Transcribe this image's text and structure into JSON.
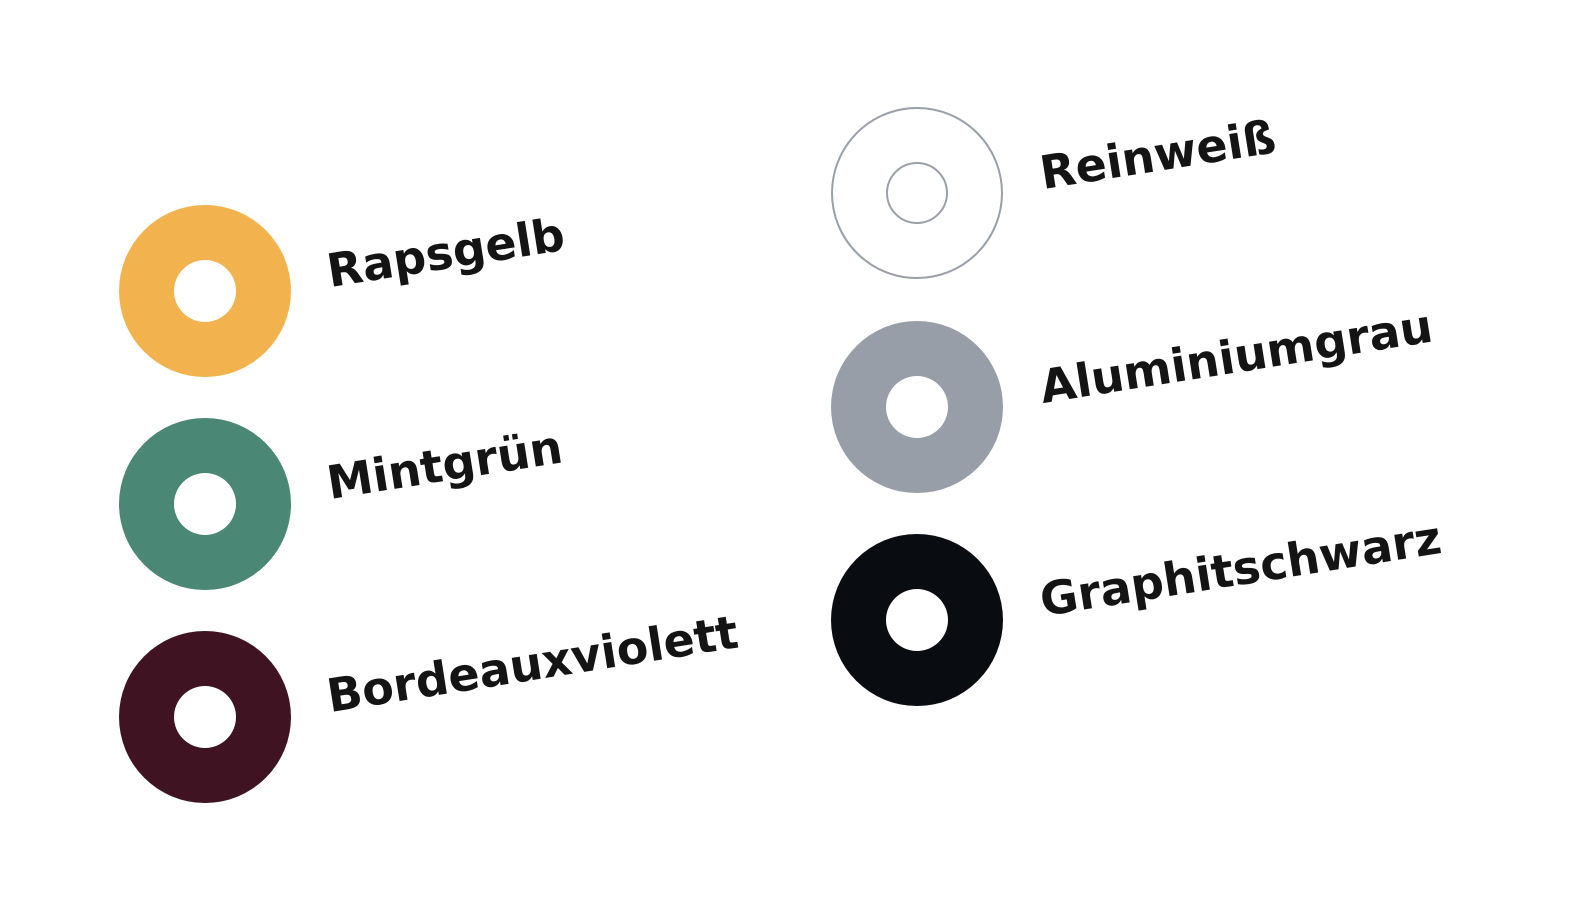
{
  "colors": [
    {
      "name": "Rapsgelb",
      "hex": "#f2b24e"
    },
    {
      "name": "Mintgrün",
      "hex": "#4a8875"
    },
    {
      "name": "Bordeauxviolett",
      "hex": "#3f1321"
    },
    {
      "name": "Reinweiß",
      "hex": "#ffffff"
    },
    {
      "name": "Aluminiumgrau",
      "hex": "#979ea7"
    },
    {
      "name": "Graphitschwarz",
      "hex": "#090c11"
    }
  ]
}
